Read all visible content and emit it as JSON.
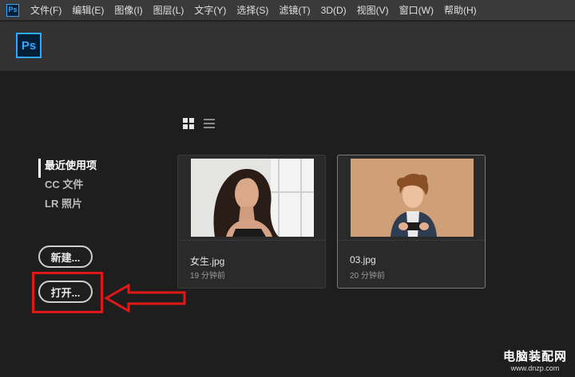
{
  "app": {
    "small_logo": "Ps",
    "big_logo": "Ps"
  },
  "menu": [
    "文件(F)",
    "编辑(E)",
    "图像(I)",
    "图层(L)",
    "文字(Y)",
    "选择(S)",
    "滤镜(T)",
    "3D(D)",
    "视图(V)",
    "窗口(W)",
    "帮助(H)"
  ],
  "sidebar": {
    "items": [
      {
        "label": "最近使用项",
        "active": true
      },
      {
        "label": "CC 文件",
        "active": false
      },
      {
        "label": "LR 照片",
        "active": false
      }
    ]
  },
  "buttons": {
    "new_label": "新建...",
    "open_label": "打开..."
  },
  "view_toggle": {
    "grid_icon": "grid-view-icon",
    "list_icon": "list-view-icon"
  },
  "recent_files": [
    {
      "name": "女生.jpg",
      "time": "19 分钟前"
    },
    {
      "name": "03.jpg",
      "time": "20 分钟前"
    }
  ],
  "watermark": {
    "title": "电脑装配网",
    "url": "www.dnzp.com"
  },
  "colors": {
    "accent": "#31a8ff",
    "highlight": "#e01818",
    "background": "#1e1e1e"
  }
}
